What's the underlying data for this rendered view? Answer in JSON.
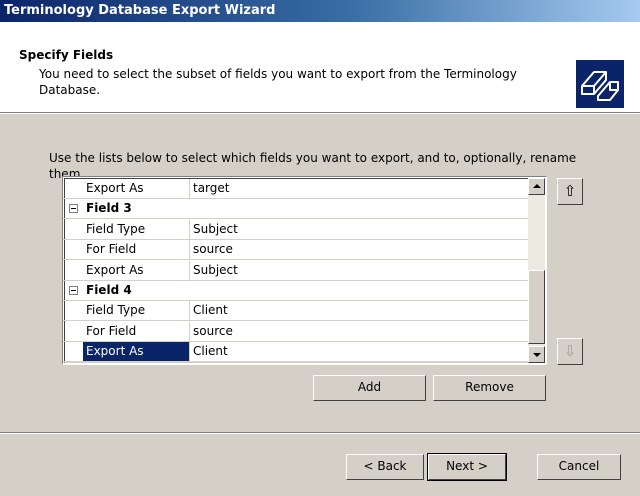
{
  "window": {
    "title": "Terminology Database Export Wizard"
  },
  "header": {
    "title": "Specify Fields",
    "description": "You need to select the subset of fields you want to export from the Terminology Database."
  },
  "instructions": "Use the lists below to select which fields you want to export, and to, optionally, rename them.",
  "grid": {
    "rows": [
      {
        "type": "prop",
        "name": "Export As",
        "value": "target"
      },
      {
        "type": "category",
        "name": "Field 3"
      },
      {
        "type": "prop",
        "name": "Field Type",
        "value": "Subject"
      },
      {
        "type": "prop",
        "name": "For Field",
        "value": "source"
      },
      {
        "type": "prop",
        "name": "Export As",
        "value": "Subject"
      },
      {
        "type": "category",
        "name": "Field 4"
      },
      {
        "type": "prop",
        "name": "Field Type",
        "value": "Client"
      },
      {
        "type": "prop",
        "name": "For Field",
        "value": "source"
      },
      {
        "type": "prop",
        "name": "Export As",
        "value": "Client",
        "selected": true
      }
    ]
  },
  "icons": {
    "move_up": "⇧",
    "move_down": "⇩"
  },
  "buttons": {
    "add": "Add",
    "remove": "Remove",
    "back": "< Back",
    "next": "Next >",
    "cancel": "Cancel"
  }
}
